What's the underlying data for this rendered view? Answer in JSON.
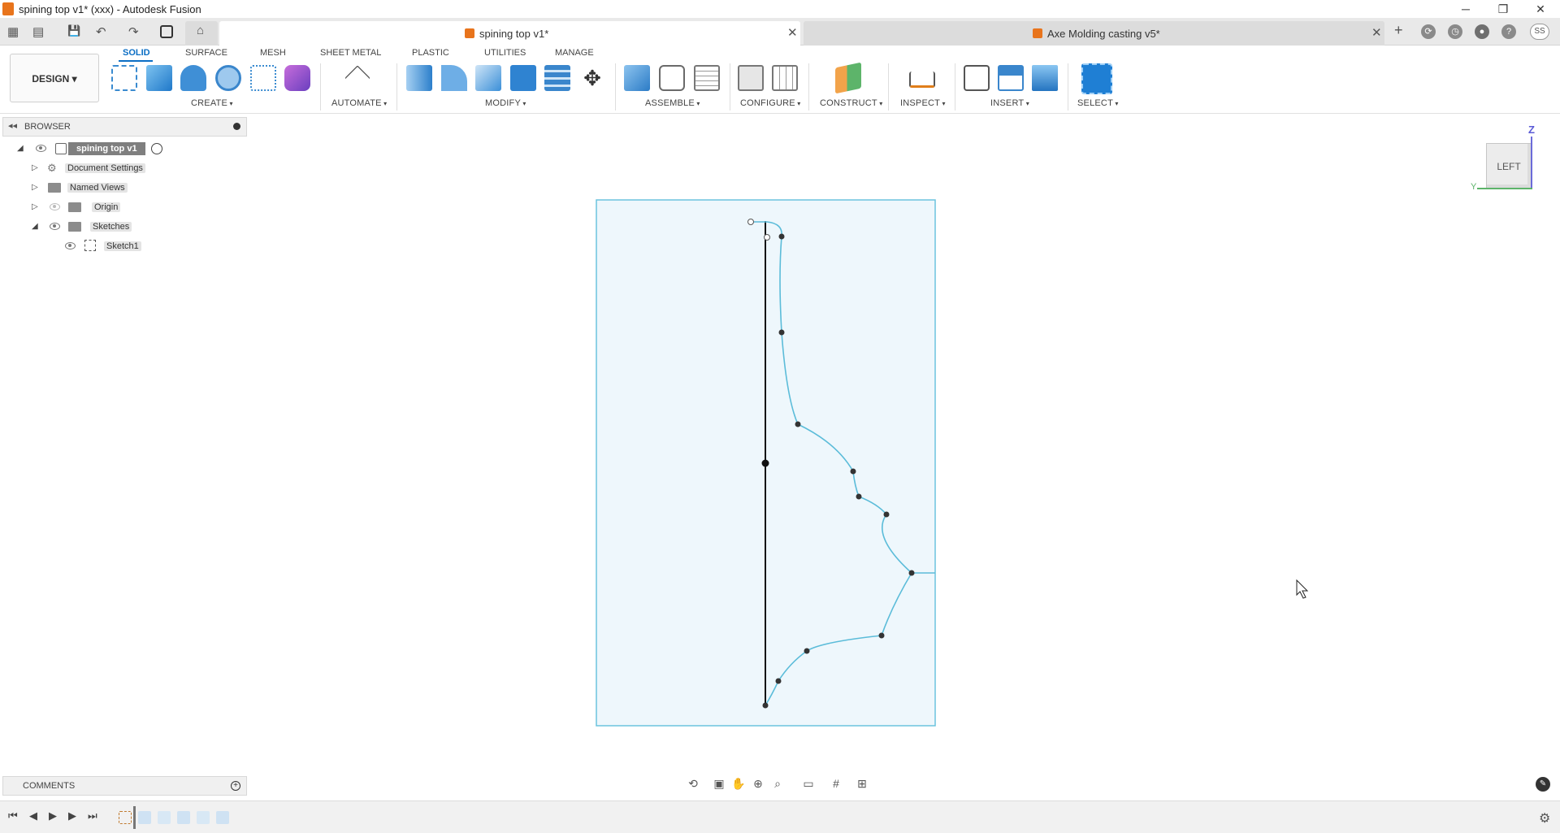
{
  "window": {
    "title": "spining top v1* (xxx) - Autodesk Fusion",
    "minimize": "─",
    "maximize": "❐",
    "close": "✕"
  },
  "tabs": [
    {
      "label": "spining top v1*",
      "close": "✕",
      "active": true
    },
    {
      "label": "Axe Molding casting v5*",
      "close": "✕",
      "active": false
    }
  ],
  "quick_access": {
    "grid": "▦",
    "file": "▤",
    "save": "💾",
    "undo": "↶",
    "redo": "↷",
    "home": "⌂",
    "new_tab": "+",
    "user_initials": "SS"
  },
  "ribbon": {
    "design_label": "DESIGN ▾",
    "tabs": [
      "SOLID",
      "SURFACE",
      "MESH",
      "SHEET METAL",
      "PLASTIC",
      "UTILITIES",
      "MANAGE"
    ],
    "active_tab": "SOLID",
    "groups": [
      "CREATE",
      "AUTOMATE",
      "MODIFY",
      "ASSEMBLE",
      "CONFIGURE",
      "CONSTRUCT",
      "INSPECT",
      "INSERT",
      "SELECT"
    ]
  },
  "browser": {
    "label": "BROWSER",
    "root": "spining top v1",
    "items": [
      {
        "label": "Document Settings"
      },
      {
        "label": "Named Views"
      },
      {
        "label": "Origin"
      },
      {
        "label": "Sketches"
      },
      {
        "label": "Sketch1"
      }
    ]
  },
  "comments": {
    "label": "COMMENTS"
  },
  "viewcube": {
    "face": "LEFT",
    "axis_z": "Z",
    "axis_y": "Y"
  },
  "colors": {
    "accent": "#0b6ec4",
    "sketch_line": "#5bbcd9",
    "sketch_fill": "#eef7fc",
    "sketch_border": "#6cc4de",
    "brand_orange": "#e8741c"
  },
  "timeline": {
    "first": "⏮",
    "prev": "◀",
    "play": "▶",
    "next": "▶",
    "last": "⏭"
  }
}
